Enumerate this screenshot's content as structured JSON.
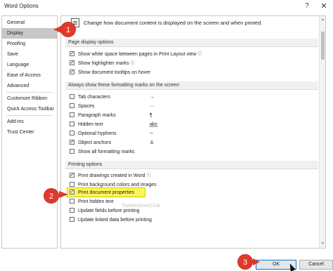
{
  "window": {
    "title": "Word Options",
    "help_label": "?",
    "close_label": "✕"
  },
  "sidebar": {
    "items": [
      {
        "label": "General"
      },
      {
        "label": "Display"
      },
      {
        "label": "Proofing"
      },
      {
        "label": "Save"
      },
      {
        "label": "Language"
      },
      {
        "label": "Ease of Access"
      },
      {
        "label": "Advanced"
      },
      {
        "label": "Customize Ribbon"
      },
      {
        "label": "Quick Access Toolbar"
      },
      {
        "label": "Add-ins"
      },
      {
        "label": "Trust Center"
      }
    ],
    "selected": "Display"
  },
  "main": {
    "intro": "Change how document content is displayed on the screen and when printed.",
    "page_display": {
      "heading": "Page display options",
      "options": [
        {
          "label": "Show white space between pages in Print Layout view",
          "checked": true,
          "info": true
        },
        {
          "label": "Show highlighter marks",
          "checked": true,
          "info": true
        },
        {
          "label": "Show document tooltips on hover",
          "checked": true,
          "info": false
        }
      ]
    },
    "formatting_marks": {
      "heading": "Always show these formatting marks on the screen",
      "options": [
        {
          "label": "Tab characters",
          "checked": false,
          "mark": "→"
        },
        {
          "label": "Spaces",
          "checked": false,
          "mark": "···"
        },
        {
          "label": "Paragraph marks",
          "checked": false,
          "mark": "¶"
        },
        {
          "label": "Hidden text",
          "checked": false,
          "mark": "abc"
        },
        {
          "label": "Optional hyphens",
          "checked": false,
          "mark": "¬"
        },
        {
          "label": "Object anchors",
          "checked": true,
          "mark": "⚓"
        },
        {
          "label": "Show all formatting marks",
          "checked": false,
          "mark": ""
        }
      ]
    },
    "printing": {
      "heading": "Printing options",
      "options": [
        {
          "label": "Print drawings created in Word",
          "checked": true,
          "info": true
        },
        {
          "label": "Print background colors and images",
          "checked": false
        },
        {
          "label": "Print document properties",
          "checked": true,
          "highlighted": true
        },
        {
          "label": "Print hidden text",
          "checked": false
        },
        {
          "label": "Update fields before printing",
          "checked": false
        },
        {
          "label": "Update linked data before printing",
          "checked": false
        }
      ]
    },
    "watermark": "TheWindowsClub"
  },
  "footer": {
    "ok_label": "OK",
    "cancel_label": "Cancel"
  },
  "callouts": [
    "1",
    "2",
    "3"
  ],
  "colors": {
    "badge": "#e0392b",
    "highlight": "#fbf55a",
    "selected_nav": "#c7c7c7"
  }
}
